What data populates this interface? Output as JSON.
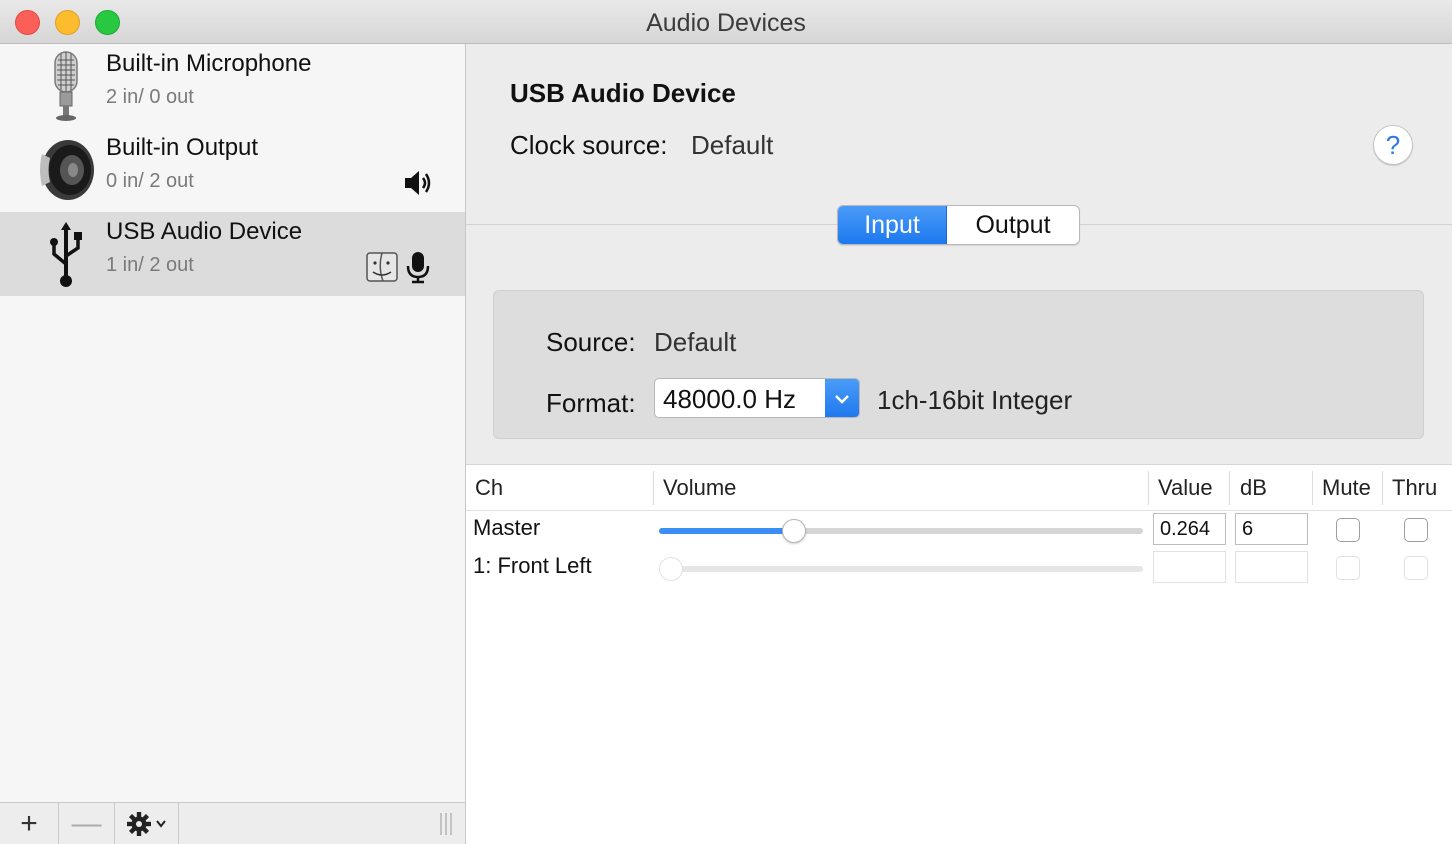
{
  "window": {
    "title": "Audio Devices"
  },
  "sidebar": {
    "devices": [
      {
        "name": "Built-in Microphone",
        "io": "2 in/ 0 out",
        "icon": "microphone-icon"
      },
      {
        "name": "Built-in Output",
        "io": "0 in/ 2 out",
        "icon": "speaker-icon",
        "badges": [
          "sound-output-icon"
        ]
      },
      {
        "name": "USB Audio Device",
        "io": "1 in/ 2 out",
        "icon": "usb-icon",
        "selected": true,
        "badges": [
          "finder-icon",
          "sound-input-icon"
        ]
      }
    ],
    "bottom": {
      "add": "+",
      "remove": "—",
      "gear": "gear-icon"
    }
  },
  "detail": {
    "device_title": "USB Audio Device",
    "clock_label": "Clock source:",
    "clock_value": "Default",
    "help": "?",
    "tabs": [
      {
        "label": "Input",
        "active": true
      },
      {
        "label": "Output",
        "active": false
      }
    ],
    "source_label": "Source:",
    "source_value": "Default",
    "format_label": "Format:",
    "format_value": "48000.0 Hz",
    "format_detail": "1ch-16bit Integer"
  },
  "table": {
    "headers": {
      "ch": "Ch",
      "volume": "Volume",
      "value": "Value",
      "db": "dB",
      "mute": "Mute",
      "thru": "Thru"
    },
    "rows": [
      {
        "ch": "Master",
        "volume": 0.278,
        "value": "0.264",
        "db": "6",
        "mute": false,
        "thru": false,
        "enabled": true
      },
      {
        "ch": "1: Front Left",
        "volume": 0.0,
        "value": "",
        "db": "",
        "mute": false,
        "thru": false,
        "enabled": false
      }
    ]
  },
  "colors": {
    "accent": "#1d78ef",
    "selection": "#dcdcdc"
  }
}
